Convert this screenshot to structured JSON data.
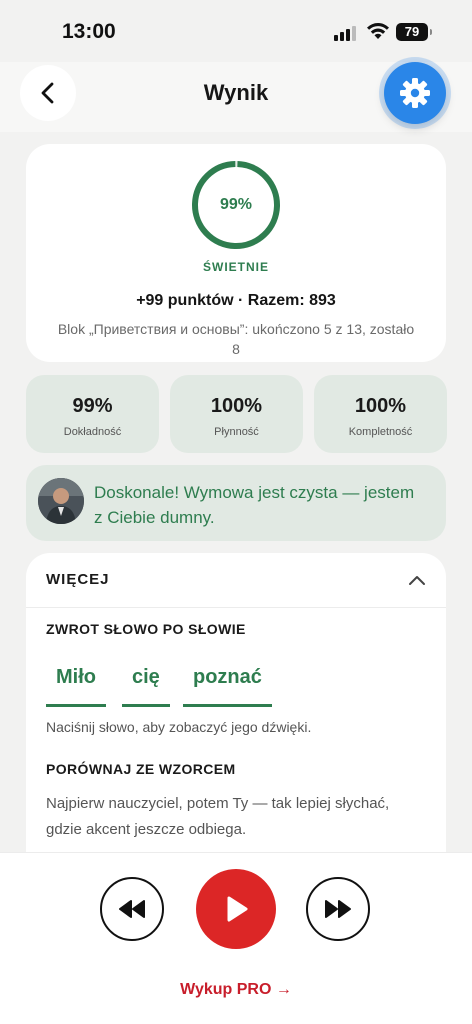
{
  "status_bar": {
    "time": "13:00",
    "battery": "79"
  },
  "header": {
    "title": "Wynik"
  },
  "score": {
    "percent_label": "99%",
    "progress_fraction": 0.99,
    "rating": "ŚWIETNIE",
    "points_line": "+99 punktów · Razem: 893",
    "block_info": "Blok „Приветствия и основы”: ukończono 5 z 13, zostało 8"
  },
  "metrics": [
    {
      "value": "99%",
      "label": "Dokładność"
    },
    {
      "value": "100%",
      "label": "Płynność"
    },
    {
      "value": "100%",
      "label": "Kompletność"
    }
  ],
  "feedback": {
    "text": "Doskonale! Wymowa jest czysta — jestem z Ciebie dumny."
  },
  "more": {
    "title": "WIĘCEJ",
    "word_by_word_title": "ZWROT SŁOWO PO SŁOWIE",
    "words": [
      "Miło",
      "cię",
      "poznać"
    ],
    "hint": "Naciśnij słowo, aby zobaczyć jego dźwięki.",
    "compare_title": "PORÓWNAJ ZE WZORCEM",
    "compare_desc": "Najpierw nauczyciel, potem Ty — tak lepiej słychać, gdzie akcent jeszcze odbiega."
  },
  "player": {
    "pro_link": "Wykup PRO →"
  },
  "colors": {
    "accent_green": "#2e7d4f",
    "settings_blue": "#2a86e8",
    "play_red": "#dc2626",
    "pro_red": "#c81e2b"
  },
  "icons": [
    "chevron-left-icon",
    "gear-icon",
    "chevron-up-icon",
    "rewind-icon",
    "play-icon",
    "fast-forward-icon",
    "wifi-icon",
    "signal-icon"
  ]
}
